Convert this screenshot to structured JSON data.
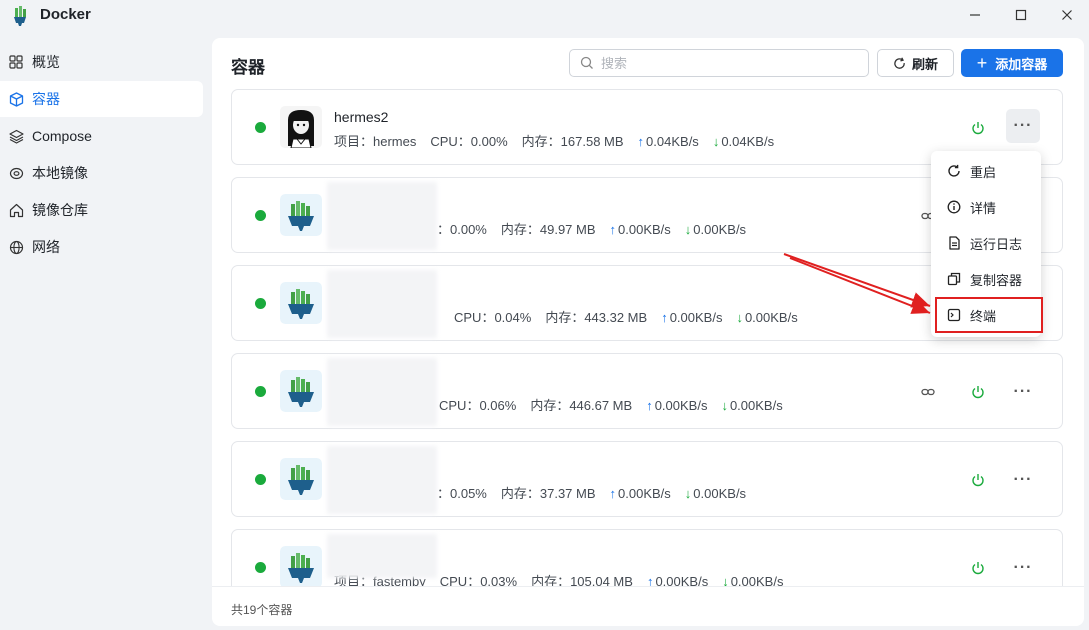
{
  "window": {
    "title": "Docker"
  },
  "sidebar": {
    "items": [
      {
        "label": "概览",
        "icon": "grid-icon",
        "active": false
      },
      {
        "label": "容器",
        "icon": "cube-icon",
        "active": true
      },
      {
        "label": "Compose",
        "icon": "layers-icon",
        "active": false
      },
      {
        "label": "本地镜像",
        "icon": "disc-icon",
        "active": false
      },
      {
        "label": "镜像仓库",
        "icon": "home-icon",
        "active": false
      },
      {
        "label": "网络",
        "icon": "globe-icon",
        "active": false
      }
    ]
  },
  "main": {
    "title": "容器",
    "search_placeholder": "搜索",
    "refresh_label": "刷新",
    "add_label": "添加容器",
    "footer": "共19个容器"
  },
  "containers": [
    {
      "name": "hermes2",
      "project_label": "项目：hermes",
      "cpu": "CPU：0.00%",
      "mem": "内存：167.58 MB",
      "up": "0.04KB/s",
      "down": "0.04KB/s"
    },
    {
      "name": "",
      "project_label": "",
      "cpu": "：0.00%",
      "mem": "内存：49.97 MB",
      "up": "0.00KB/s",
      "down": "0.00KB/s"
    },
    {
      "name": "",
      "project_label": "",
      "cpu": "CPU：0.04%",
      "mem": "内存：443.32 MB",
      "up": "0.00KB/s",
      "down": "0.00KB/s"
    },
    {
      "name": "",
      "project_label": "",
      "cpu": "CPU：0.06%",
      "mem": "内存：446.67 MB",
      "up": "0.00KB/s",
      "down": "0.00KB/s"
    },
    {
      "name": "",
      "project_label": "",
      "cpu": "：0.05%",
      "mem": "内存：37.37 MB",
      "up": "0.00KB/s",
      "down": "0.00KB/s"
    },
    {
      "name": "",
      "project_label": "项目：fastemby",
      "cpu": "CPU：0.03%",
      "mem": "内存：105.04 MB",
      "up": "0.00KB/s",
      "down": "0.00KB/s"
    }
  ],
  "menu": {
    "items": [
      {
        "label": "重启",
        "icon": "restart-icon"
      },
      {
        "label": "详情",
        "icon": "info-icon"
      },
      {
        "label": "运行日志",
        "icon": "log-icon"
      },
      {
        "label": "复制容器",
        "icon": "copy-icon"
      },
      {
        "label": "终端",
        "icon": "terminal-icon"
      }
    ]
  },
  "colors": {
    "accent": "#1a73e8",
    "running": "#1aaa3c",
    "annotation": "#e02020"
  }
}
